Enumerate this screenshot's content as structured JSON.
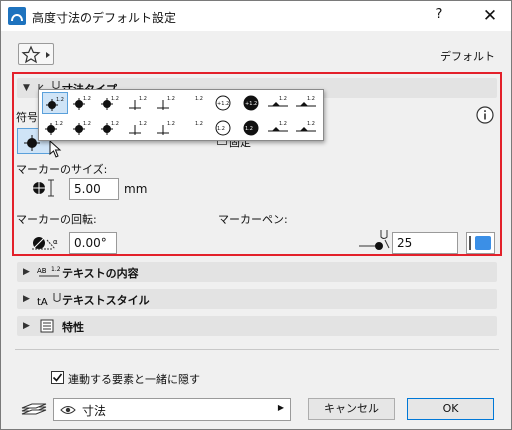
{
  "window": {
    "title": "高度寸法のデフォルト設定",
    "help_glyph": "?",
    "close_glyph": "✕"
  },
  "favorites": {
    "default_label": "デフォルト"
  },
  "sections": {
    "dimension_type": {
      "label": "寸法タイプ"
    },
    "text_content": {
      "label": "テキストの内容"
    },
    "text_style": {
      "label": "テキストスタイル"
    },
    "properties": {
      "label": "特性"
    }
  },
  "dimension_panel": {
    "symbol_type_label": "符号タ",
    "fixed_label": "固定",
    "marker_size_label": "マーカーのサイズ:",
    "marker_size_value": "5.00",
    "marker_size_unit": "mm",
    "marker_rotation_label": "マーカーの回転:",
    "marker_rotation_value": "0.00°",
    "marker_pen_label": "マーカーペン:",
    "marker_pen_value": "25",
    "pen_color": "#3b8fe6"
  },
  "symbol_popup": {
    "row1": [
      "1.2",
      "1.2",
      "1.2",
      "1.2",
      "1.2",
      "1.2",
      "+1.2",
      "+1.2",
      "1.2",
      "1.2"
    ],
    "row2": [
      "1.2",
      "1.2",
      "1.2",
      "1.2",
      "1.2",
      "1.2",
      "1.2",
      "1.2",
      "1.2",
      "1.2"
    ]
  },
  "footer": {
    "hide_checkbox_label": "連動する要素と一緒に隠す",
    "layer_value": "寸法",
    "cancel_label": "キャンセル",
    "ok_label": "OK"
  },
  "colors": {
    "highlight_border": "#e3202a",
    "accent": "#0078d7"
  }
}
